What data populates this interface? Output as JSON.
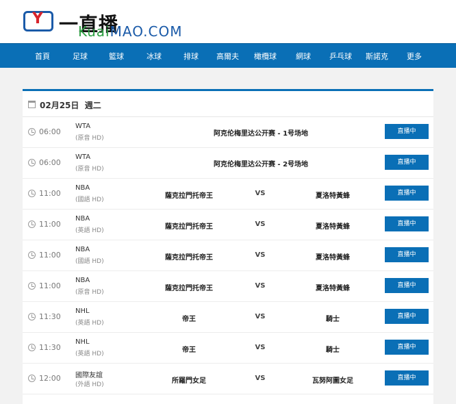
{
  "brand": {
    "logo_glyph": "Y",
    "title": "一直播",
    "domain_prefix": "Kuai",
    "domain_suffix": "MAO.COM",
    "colors": {
      "blue": "#1a5aa8",
      "red": "#d8242c",
      "green": "#2ea043"
    }
  },
  "nav": {
    "items": [
      "首頁",
      "足球",
      "籃球",
      "冰球",
      "排球",
      "高爾夫",
      "橄欖球",
      "網球",
      "乒乓球",
      "斯諾克",
      "更多"
    ],
    "color": "#0a6fb6"
  },
  "schedule": {
    "date": "02月25日",
    "weekday": "週二",
    "live_label": "直播中",
    "vs_label": "VS",
    "rows": [
      {
        "time": "06:00",
        "league": "WTA",
        "channel": "(原音 HD)",
        "title": "阿克伦梅里达公开赛 - 1号场地"
      },
      {
        "time": "06:00",
        "league": "WTA",
        "channel": "(原音 HD)",
        "title": "阿克伦梅里达公开赛 - 2号场地"
      },
      {
        "time": "11:00",
        "league": "NBA",
        "channel": "(國語 HD)",
        "home": "薩克拉門托帝王",
        "away": "夏洛特黃蜂"
      },
      {
        "time": "11:00",
        "league": "NBA",
        "channel": "(英語 HD)",
        "home": "薩克拉門托帝王",
        "away": "夏洛特黃蜂"
      },
      {
        "time": "11:00",
        "league": "NBA",
        "channel": "(國語 HD)",
        "home": "薩克拉門托帝王",
        "away": "夏洛特黃蜂"
      },
      {
        "time": "11:00",
        "league": "NBA",
        "channel": "(原音 HD)",
        "home": "薩克拉門托帝王",
        "away": "夏洛特黃蜂"
      },
      {
        "time": "11:30",
        "league": "NHL",
        "channel": "(英語 HD)",
        "home": "帝王",
        "away": "騎士"
      },
      {
        "time": "11:30",
        "league": "NHL",
        "channel": "(英語 HD)",
        "home": "帝王",
        "away": "騎士"
      },
      {
        "time": "12:00",
        "league": "國際友誼",
        "channel": "(外語 HD)",
        "home": "所羅門女足",
        "away": "瓦努阿圖女足"
      }
    ]
  }
}
